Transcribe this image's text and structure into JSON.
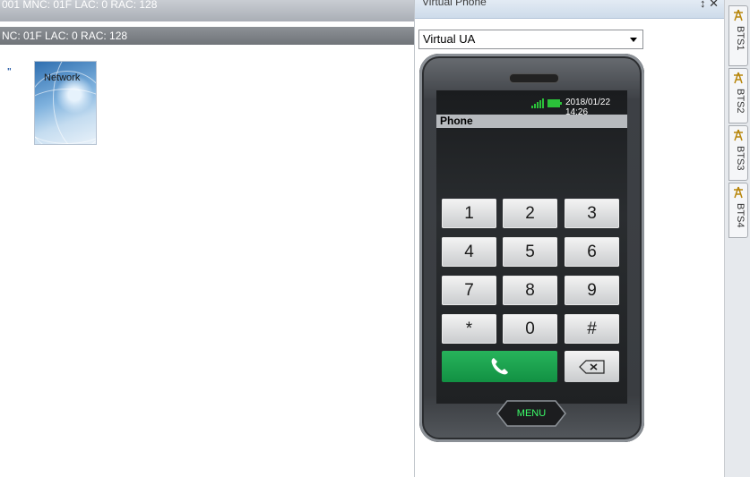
{
  "left": {
    "bar1_text": "001  MNC: 01F  LAC: 0  RAC: 128",
    "bar2_text": "NC: 01F    LAC: 0    RAC: 128",
    "marker": "\"",
    "network_icon_label": "Network"
  },
  "panel": {
    "title": "Virtual Phone",
    "pin_icon": "pin-icon",
    "close_icon": "close-icon",
    "select_value": "Virtual UA"
  },
  "phone": {
    "datetime": "2018/01/22 14:26",
    "screen_title": "Phone",
    "keys": [
      "1",
      "2",
      "3",
      "4",
      "5",
      "6",
      "7",
      "8",
      "9",
      "*",
      "0",
      "#"
    ],
    "menu_label": "MENU",
    "signal_color": "#2bc23a",
    "call_color": "#1aa34c"
  },
  "bts_tabs": [
    "BTS1",
    "BTS2",
    "BTS3",
    "BTS4"
  ]
}
